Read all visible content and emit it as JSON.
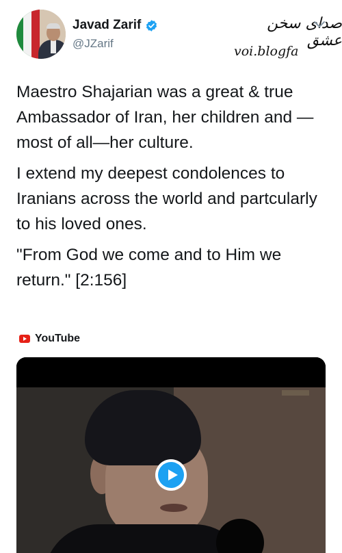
{
  "author": {
    "name": "Javad Zarif",
    "handle": "@JZarif",
    "verified_icon": "verified-badge-icon",
    "accent_color": "#1da1f2"
  },
  "watermark": {
    "top_text": "صدای سخن عشق",
    "bottom_text": "voi.blogfa"
  },
  "tweet": {
    "paragraphs": [
      "Maestro Shajarian was a great & true Ambassador of Iran, her children and —most of all—her culture.",
      "I extend my deepest condolences to Iranians across the world and partcularly to his loved ones.",
      "\"From God we come and to Him we return.\" [2:156]"
    ]
  },
  "media": {
    "source_label": "YouTube",
    "source_icon": "youtube-icon",
    "play_icon": "play-icon"
  }
}
